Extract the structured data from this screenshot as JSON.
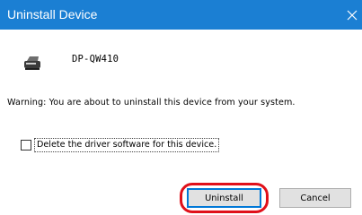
{
  "window": {
    "title": "Uninstall Device",
    "close_icon": "close-icon",
    "title_bar_color": "#1b7fd3"
  },
  "device": {
    "icon": "printer-icon",
    "name": "DP-QW410"
  },
  "warning_text": "Warning: You are about to uninstall this device from your system.",
  "option": {
    "label": "Delete the driver software for this device.",
    "checked": false
  },
  "buttons": {
    "uninstall": "Uninstall",
    "cancel": "Cancel"
  },
  "highlight_color": "#e0101a"
}
